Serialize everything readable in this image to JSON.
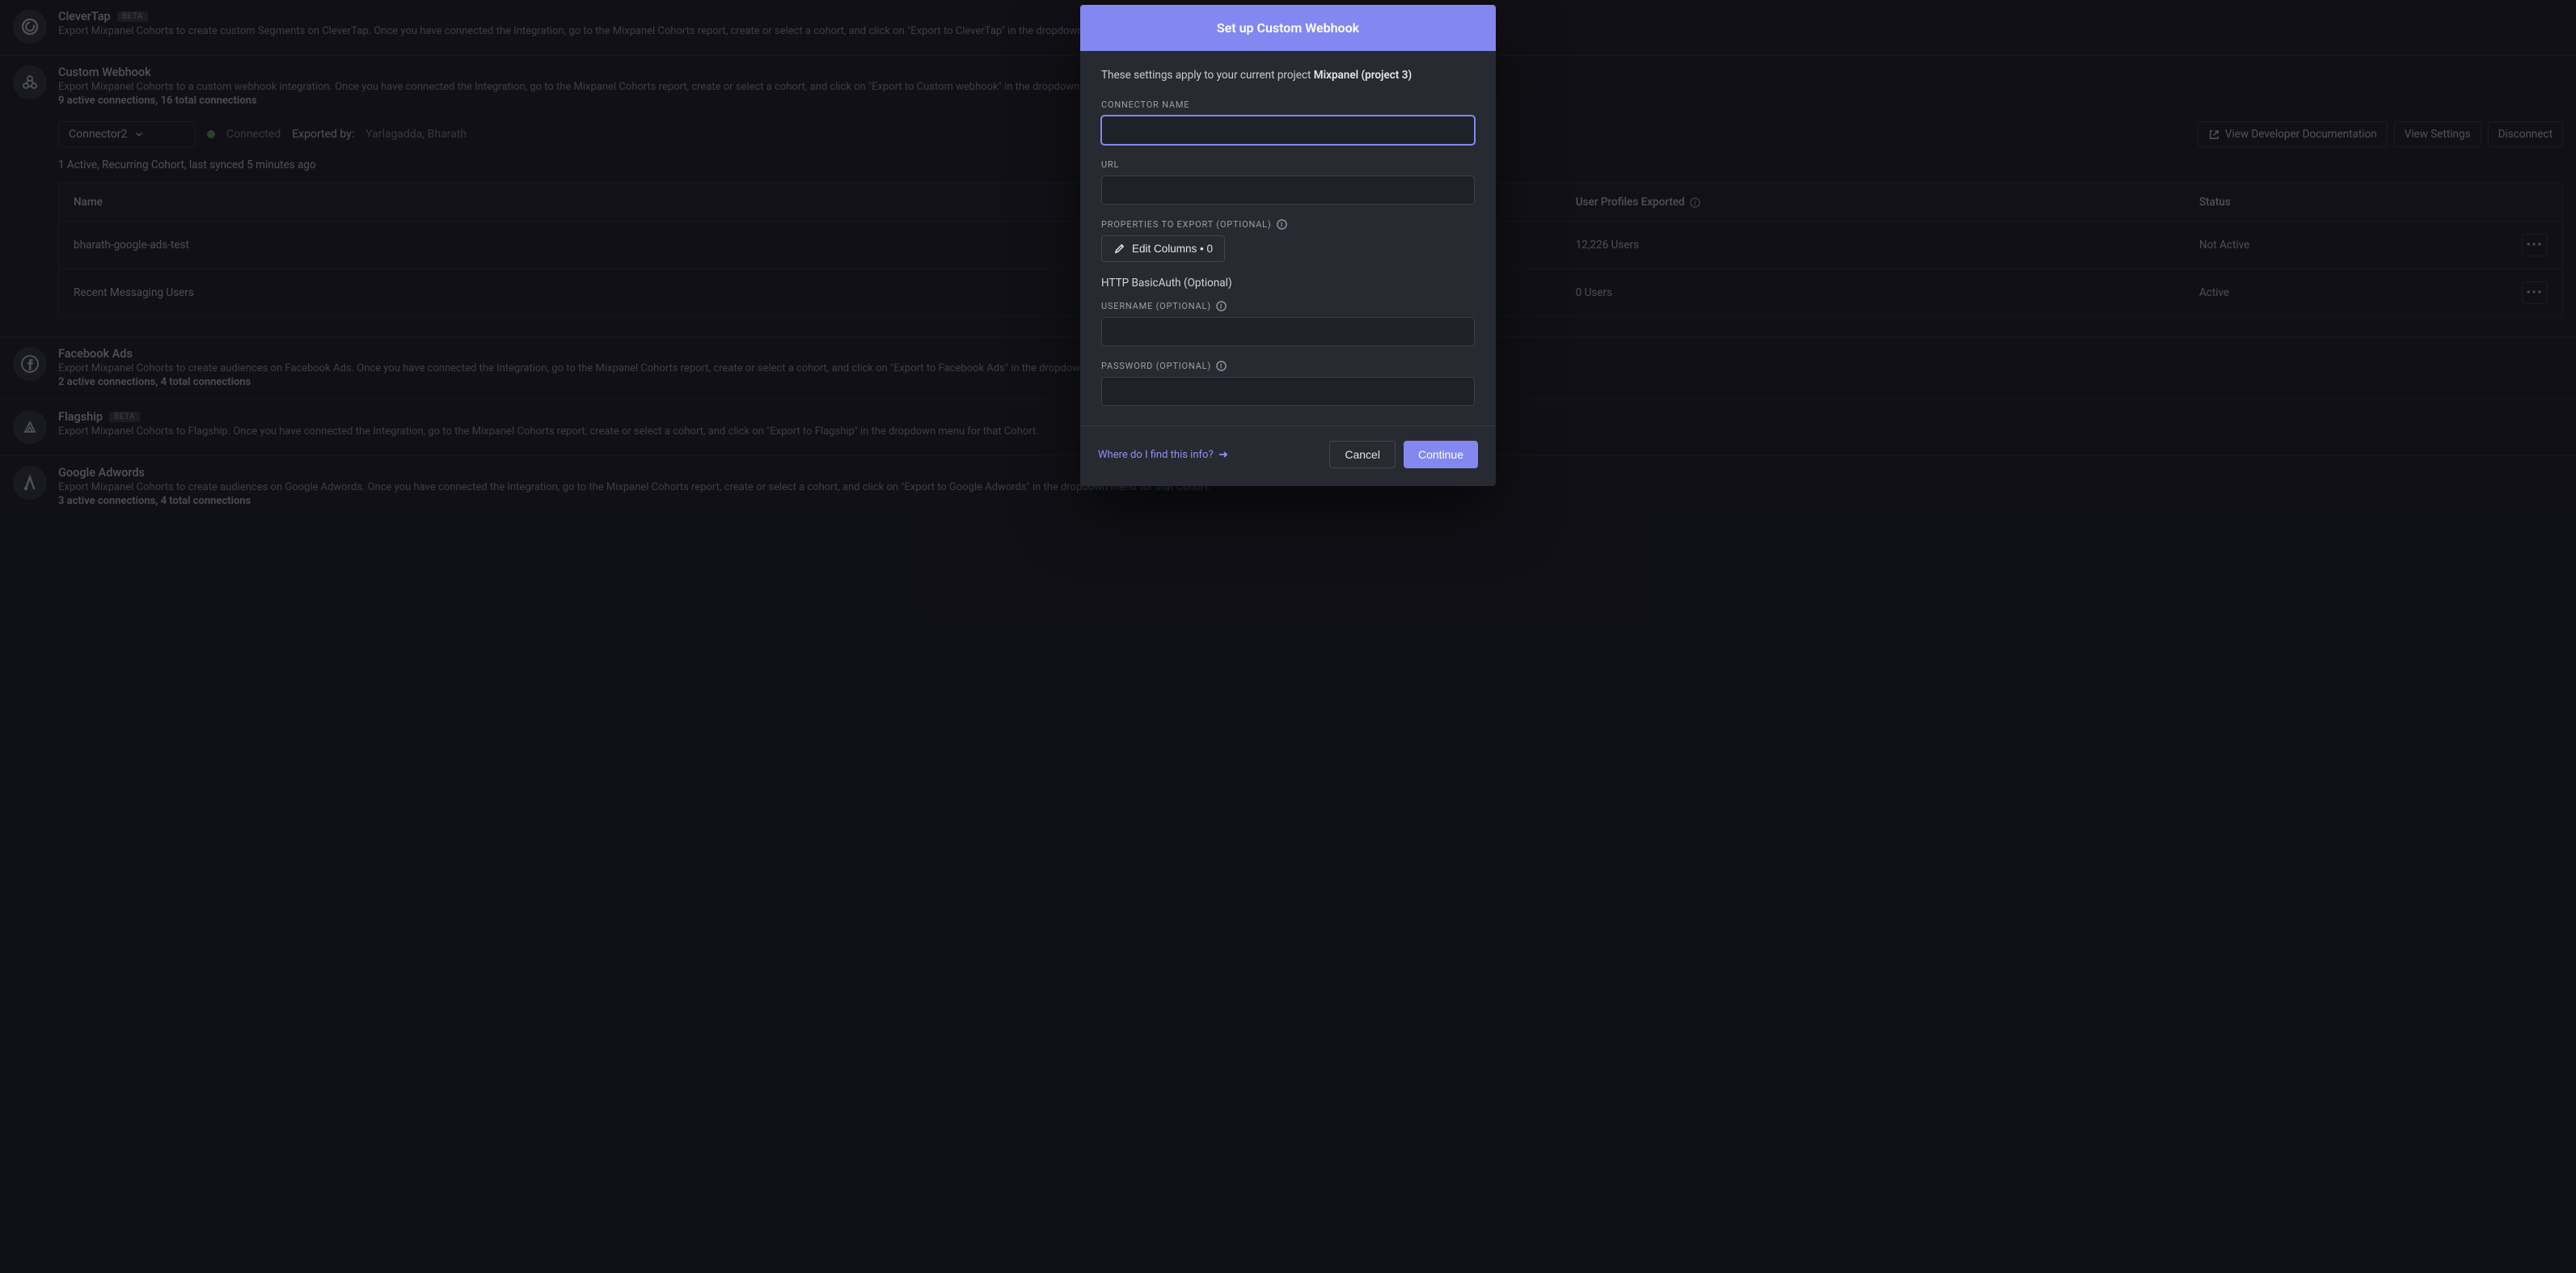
{
  "modal": {
    "title": "Set up Custom Webhook",
    "project_line_prefix": "These settings apply to your current project ",
    "project_name": "Mixpanel (project 3)",
    "connector_name_label": "CONNECTOR NAME",
    "url_label": "URL",
    "properties_label": "PROPERTIES TO EXPORT (OPTIONAL)",
    "edit_columns_label": "Edit Columns • 0",
    "basic_auth_heading": "HTTP BasicAuth (Optional)",
    "username_label": "USERNAME (OPTIONAL)",
    "password_label": "PASSWORD (OPTIONAL)",
    "help_link": "Where do I find this info?",
    "cancel": "Cancel",
    "continue": "Continue"
  },
  "connector_panel": {
    "selected": "Connector2",
    "status": "Connected",
    "exported_by_label": "Exported by:",
    "exported_by_value": "Yarlagadda, Bharath",
    "dev_docs": "View Developer Documentation",
    "view_settings": "View Settings",
    "disconnect": "Disconnect",
    "sync_text": "1 Active, Recurring Cohort, last synced 5 minutes ago"
  },
  "table": {
    "col_name": "Name",
    "col_users": "User Profiles Exported",
    "col_status": "Status",
    "rows": [
      {
        "name": "bharath-google-ads-test",
        "users": "12,226 Users",
        "status": "Not Active"
      },
      {
        "name": "Recent Messaging Users",
        "users": "0 Users",
        "status": "Active"
      }
    ]
  },
  "integrations": {
    "clevertap": {
      "title": "CleverTap",
      "badge": "BETA",
      "desc": "Export Mixpanel Cohorts to create custom Segments on CleverTap. Once you have connected the Integration, go to the Mixpanel Cohorts report, create or select a cohort, and click on \"Export to CleverTap\" in the dropdown menu for that Cohort."
    },
    "custom_webhook": {
      "title": "Custom Webhook",
      "desc": "Export Mixpanel Cohorts to a custom webhook integration. Once you have connected the Integration, go to the Mixpanel Cohorts report, create or select a cohort, and click on \"Export to Custom webhook\" in the dropdown menu for that Cohort.",
      "stats": "9 active connections, 16 total connections"
    },
    "facebook": {
      "title": "Facebook Ads",
      "desc": "Export Mixpanel Cohorts to create audiences on Facebook Ads. Once you have connected the Integration, go to the Mixpanel Cohorts report, create or select a cohort, and click on \"Export to Facebook Ads\" in the dropdown menu for that Cohort.",
      "stats": "2 active connections, 4 total connections"
    },
    "flagship": {
      "title": "Flagship",
      "badge": "BETA",
      "desc": "Export Mixpanel Cohorts to Flagship. Once you have connected the Integration, go to the Mixpanel Cohorts report, create or select a cohort, and click on \"Export to Flagship\" in the dropdown menu for that Cohort."
    },
    "adwords": {
      "title": "Google Adwords",
      "desc": "Export Mixpanel Cohorts to create audiences on Google Adwords. Once you have connected the Integration, go to the Mixpanel Cohorts report, create or select a cohort, and click on \"Export to Google Adwords\" in the dropdown menu for that Cohort.",
      "stats": "3 active connections, 4 total connections"
    }
  }
}
